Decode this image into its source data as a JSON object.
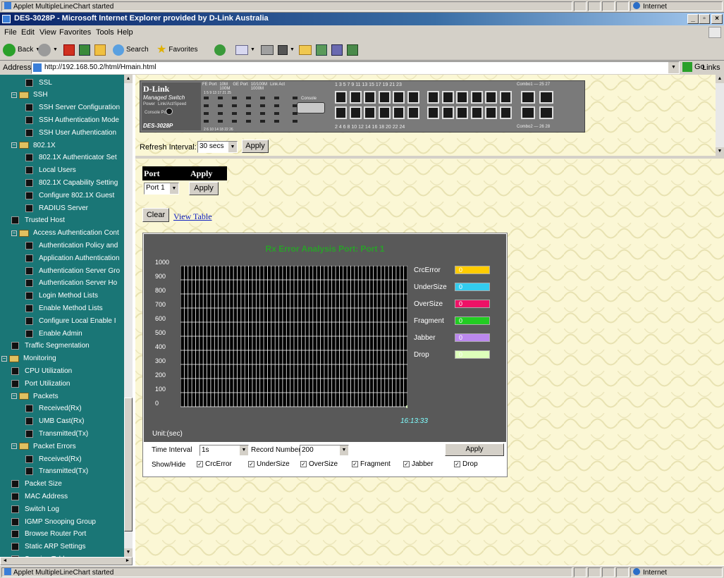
{
  "top_status": {
    "text": "Applet MultipleLineChart started",
    "zone": "Internet"
  },
  "window": {
    "title": "DES-3028P - Microsoft Internet Explorer provided by D-Link Australia"
  },
  "menu": [
    "File",
    "Edit",
    "View",
    "Favorites",
    "Tools",
    "Help"
  ],
  "toolbar": {
    "back": "Back",
    "search": "Search",
    "favorites": "Favorites"
  },
  "address": {
    "label": "Address",
    "url": "http://192.168.50.2/html/Hmain.html",
    "go": "Go",
    "links": "Links"
  },
  "sidebar": [
    {
      "label": "SSL",
      "level": 1,
      "type": "doc"
    },
    {
      "label": "SSH",
      "level": 0,
      "type": "folder"
    },
    {
      "label": "SSH Server Configuration",
      "level": 1,
      "type": "doc"
    },
    {
      "label": "SSH Authentication Mode",
      "level": 1,
      "type": "doc"
    },
    {
      "label": "SSH User Authentication",
      "level": 1,
      "type": "doc"
    },
    {
      "label": "802.1X",
      "level": 0,
      "type": "folder"
    },
    {
      "label": "802.1X Authenticator Set",
      "level": 1,
      "type": "doc"
    },
    {
      "label": "Local Users",
      "level": 1,
      "type": "doc"
    },
    {
      "label": "802.1X Capability Setting",
      "level": 1,
      "type": "doc"
    },
    {
      "label": "Configure 802.1X Guest",
      "level": 1,
      "type": "doc"
    },
    {
      "label": "RADIUS Server",
      "level": 1,
      "type": "doc"
    },
    {
      "label": "Trusted Host",
      "level": 0,
      "type": "doc"
    },
    {
      "label": "Access Authentication Cont",
      "level": 0,
      "type": "folder"
    },
    {
      "label": "Authentication Policy and",
      "level": 1,
      "type": "doc"
    },
    {
      "label": "Application Authentication",
      "level": 1,
      "type": "doc"
    },
    {
      "label": "Authentication Server Gro",
      "level": 1,
      "type": "doc"
    },
    {
      "label": "Authentication Server Ho",
      "level": 1,
      "type": "doc"
    },
    {
      "label": "Login Method Lists",
      "level": 1,
      "type": "doc"
    },
    {
      "label": "Enable Method Lists",
      "level": 1,
      "type": "doc"
    },
    {
      "label": "Configure Local Enable I",
      "level": 1,
      "type": "doc"
    },
    {
      "label": "Enable Admin",
      "level": 1,
      "type": "doc"
    },
    {
      "label": "Traffic Segmentation",
      "level": 0,
      "type": "doc"
    },
    {
      "label": "Monitoring",
      "level": -1,
      "type": "folder"
    },
    {
      "label": "CPU Utilization",
      "level": 0,
      "type": "doc"
    },
    {
      "label": "Port Utilization",
      "level": 0,
      "type": "doc"
    },
    {
      "label": "Packets",
      "level": 0,
      "type": "folder"
    },
    {
      "label": "Received(Rx)",
      "level": 1,
      "type": "doc"
    },
    {
      "label": "UMB Cast(Rx)",
      "level": 1,
      "type": "doc"
    },
    {
      "label": "Transmitted(Tx)",
      "level": 1,
      "type": "doc"
    },
    {
      "label": "Packet Errors",
      "level": 0,
      "type": "folder"
    },
    {
      "label": "Received(Rx)",
      "level": 1,
      "type": "doc"
    },
    {
      "label": "Transmitted(Tx)",
      "level": 1,
      "type": "doc"
    },
    {
      "label": "Packet Size",
      "level": 0,
      "type": "doc"
    },
    {
      "label": "MAC Address",
      "level": 0,
      "type": "doc"
    },
    {
      "label": "Switch Log",
      "level": 0,
      "type": "doc"
    },
    {
      "label": "IGMP Snooping Group",
      "level": 0,
      "type": "doc"
    },
    {
      "label": "Browse Router Port",
      "level": 0,
      "type": "doc"
    },
    {
      "label": "Static ARP Settings",
      "level": 0,
      "type": "doc"
    },
    {
      "label": "Session Table",
      "level": 0,
      "type": "doc"
    }
  ],
  "device": {
    "brand": "D-Link",
    "subtitle": "Managed Switch",
    "model": "DES-3028P",
    "fe_port": "FE Port",
    "ge_port": "GE Port",
    "link_act": "Link  Act",
    "console": "Console",
    "power": "Power",
    "link_speed": "Link/Act/Speed",
    "poe": "Console  PoE",
    "speed_10": "10M",
    "speed_100": "100M",
    "speed_10100": "10/100M",
    "speed_1000": "1000M",
    "top_ports": "1   3   5   7   9   11     13   15   17   19   21   23",
    "bottom_ports": "2   4   6   8   10   12     14   16   18   20   22   24",
    "combo1": "Combo1 — 25    27",
    "combo2": "Combo2 — 26    28",
    "led_top": "1   3   5   7   9   11     13   15   17   19   21   23",
    "led_nums_a": "1    5    9   13   17   21        25",
    "led_nums_b": "2    6   10   14   18   22        26"
  },
  "refresh": {
    "label": "Refresh Interval:",
    "value": "30 secs",
    "apply": "Apply"
  },
  "port_table": {
    "col_port": "Port",
    "col_apply": "Apply",
    "port_value": "Port 1",
    "apply": "Apply"
  },
  "actions": {
    "clear": "Clear",
    "view_table": "View Table"
  },
  "chart_data": {
    "type": "line",
    "title": "Rx Error Analysis Port: Port 1",
    "xlabel": "Unit:(sec)",
    "ylabel": "",
    "ylim": [
      0,
      1000
    ],
    "yticks": [
      1000,
      900,
      800,
      700,
      600,
      500,
      400,
      300,
      200,
      100,
      0
    ],
    "x": [
      "16:13:33"
    ],
    "series": [
      {
        "name": "CrcError",
        "color": "#ffcc00",
        "values": [
          0
        ],
        "current": "0"
      },
      {
        "name": "UnderSize",
        "color": "#33ccee",
        "values": [
          0
        ],
        "current": "0"
      },
      {
        "name": "OverSize",
        "color": "#ee1166",
        "values": [
          0
        ],
        "current": "0"
      },
      {
        "name": "Fragment",
        "color": "#22cc22",
        "values": [
          0
        ],
        "current": "0"
      },
      {
        "name": "Jabber",
        "color": "#bb88ee",
        "values": [
          0
        ],
        "current": "0"
      },
      {
        "name": "Drop",
        "color": "#ddffbb",
        "values": [
          0
        ],
        "current": "0"
      }
    ],
    "grid": true,
    "legend": "right"
  },
  "controls": {
    "time_interval_label": "Time Interval",
    "time_interval_value": "1s",
    "record_number_label": "Record Number",
    "record_number_value": "200",
    "apply": "Apply",
    "showhide_label": "Show/Hide",
    "checks": [
      "CrcError",
      "UnderSize",
      "OverSize",
      "Fragment",
      "Jabber",
      "Drop"
    ]
  },
  "bottom_status": {
    "text": "Applet MultipleLineChart started",
    "zone": "Internet"
  }
}
